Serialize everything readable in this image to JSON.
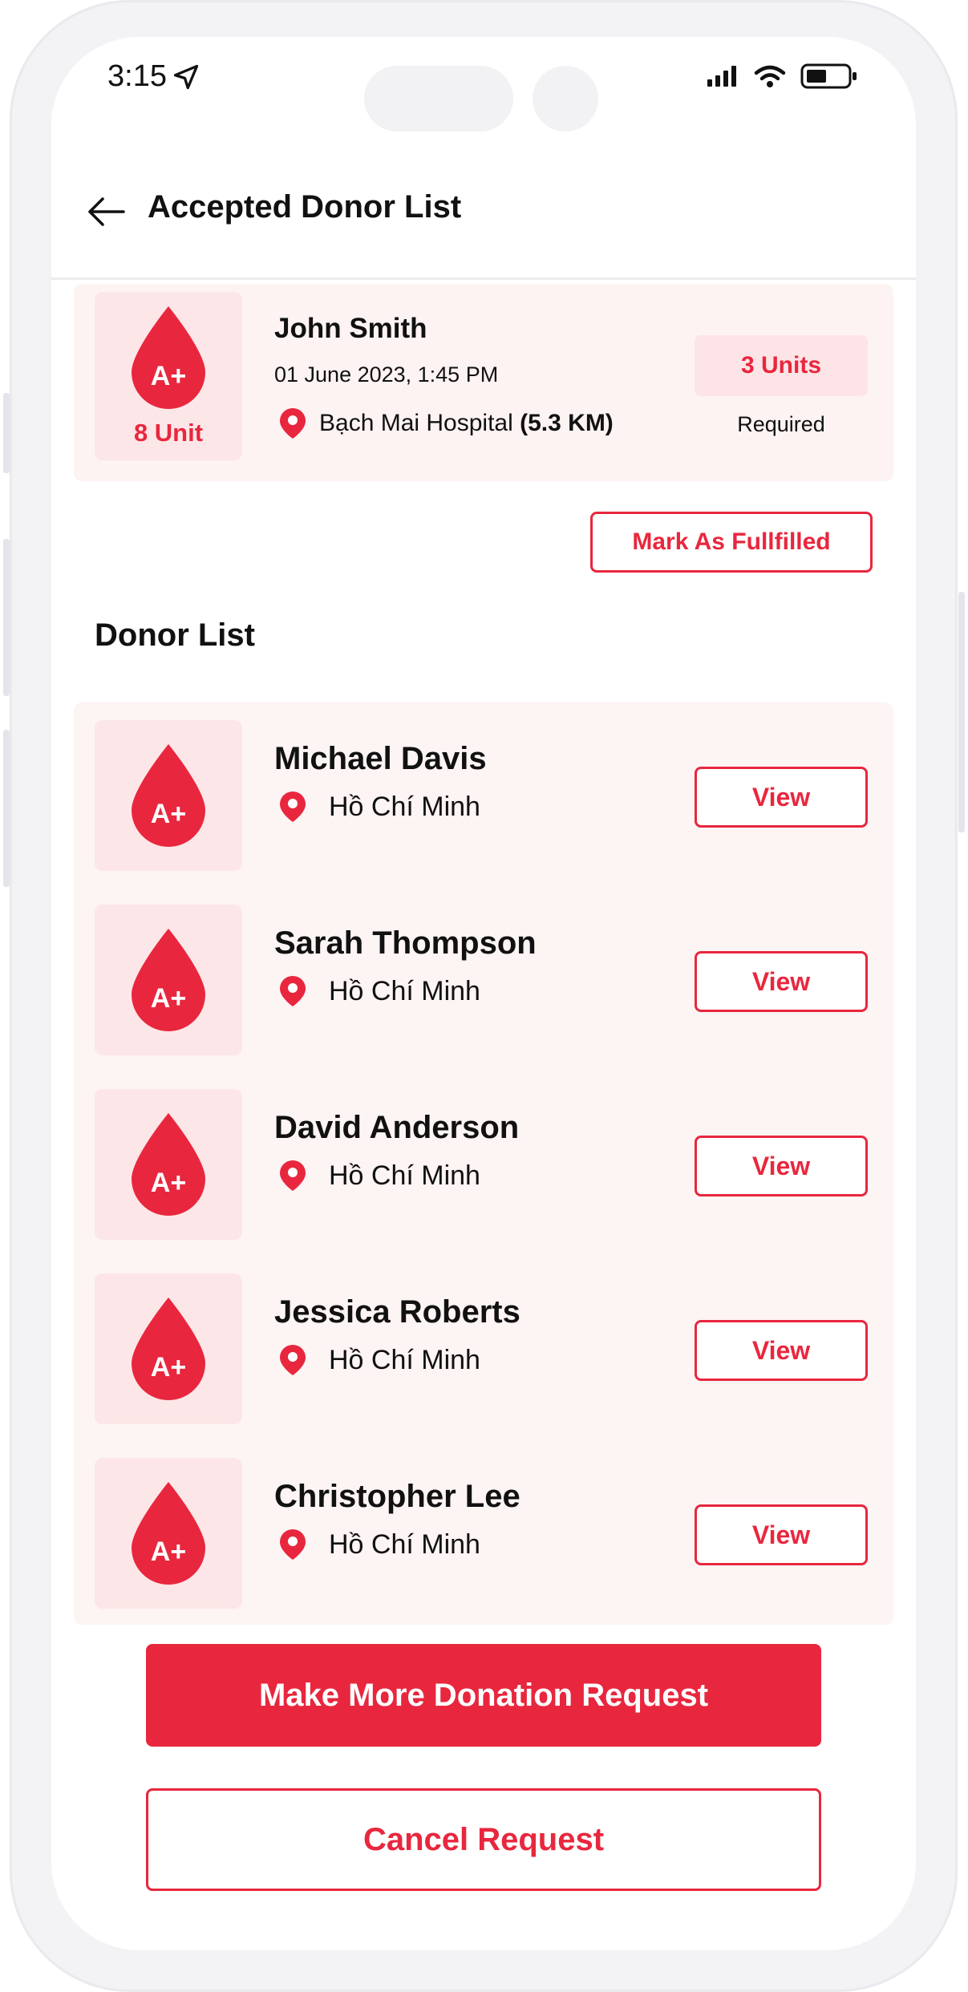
{
  "status_bar": {
    "time": "3:15"
  },
  "header": {
    "title": "Accepted Donor List"
  },
  "request": {
    "blood_type": "A+",
    "units_available": "8 Unit",
    "name": "John Smith",
    "datetime": "01 June 2023, 1:45 PM",
    "hospital": "Bạch Mai Hospital",
    "distance": "(5.3 KM)",
    "units_needed": "3 Units",
    "units_needed_caption": "Required"
  },
  "mark_fulfilled_label": "Mark As Fullfilled",
  "donor_list_title": "Donor List",
  "donors": [
    {
      "name": "Michael Davis",
      "blood_type": "A+",
      "location": "Hồ Chí Minh",
      "action": "View"
    },
    {
      "name": "Sarah Thompson",
      "blood_type": "A+",
      "location": "Hồ Chí Minh",
      "action": "View"
    },
    {
      "name": "David Anderson",
      "blood_type": "A+",
      "location": "Hồ Chí Minh",
      "action": "View"
    },
    {
      "name": "Jessica Roberts",
      "blood_type": "A+",
      "location": "Hồ Chí Minh",
      "action": "View"
    },
    {
      "name": "Christopher Lee",
      "blood_type": "A+",
      "location": "Hồ Chí Minh",
      "action": "View"
    }
  ],
  "primary_action": "Make More Donation Request",
  "secondary_action": "Cancel Request",
  "colors": {
    "accent": "#e8273e",
    "tile": "#fde6e7",
    "row": "#fdf4f4"
  },
  "icons": [
    "location-arrow-icon",
    "signal-icon",
    "wifi-icon",
    "battery-icon",
    "back-arrow-icon",
    "blood-drop-icon",
    "map-pin-icon"
  ]
}
